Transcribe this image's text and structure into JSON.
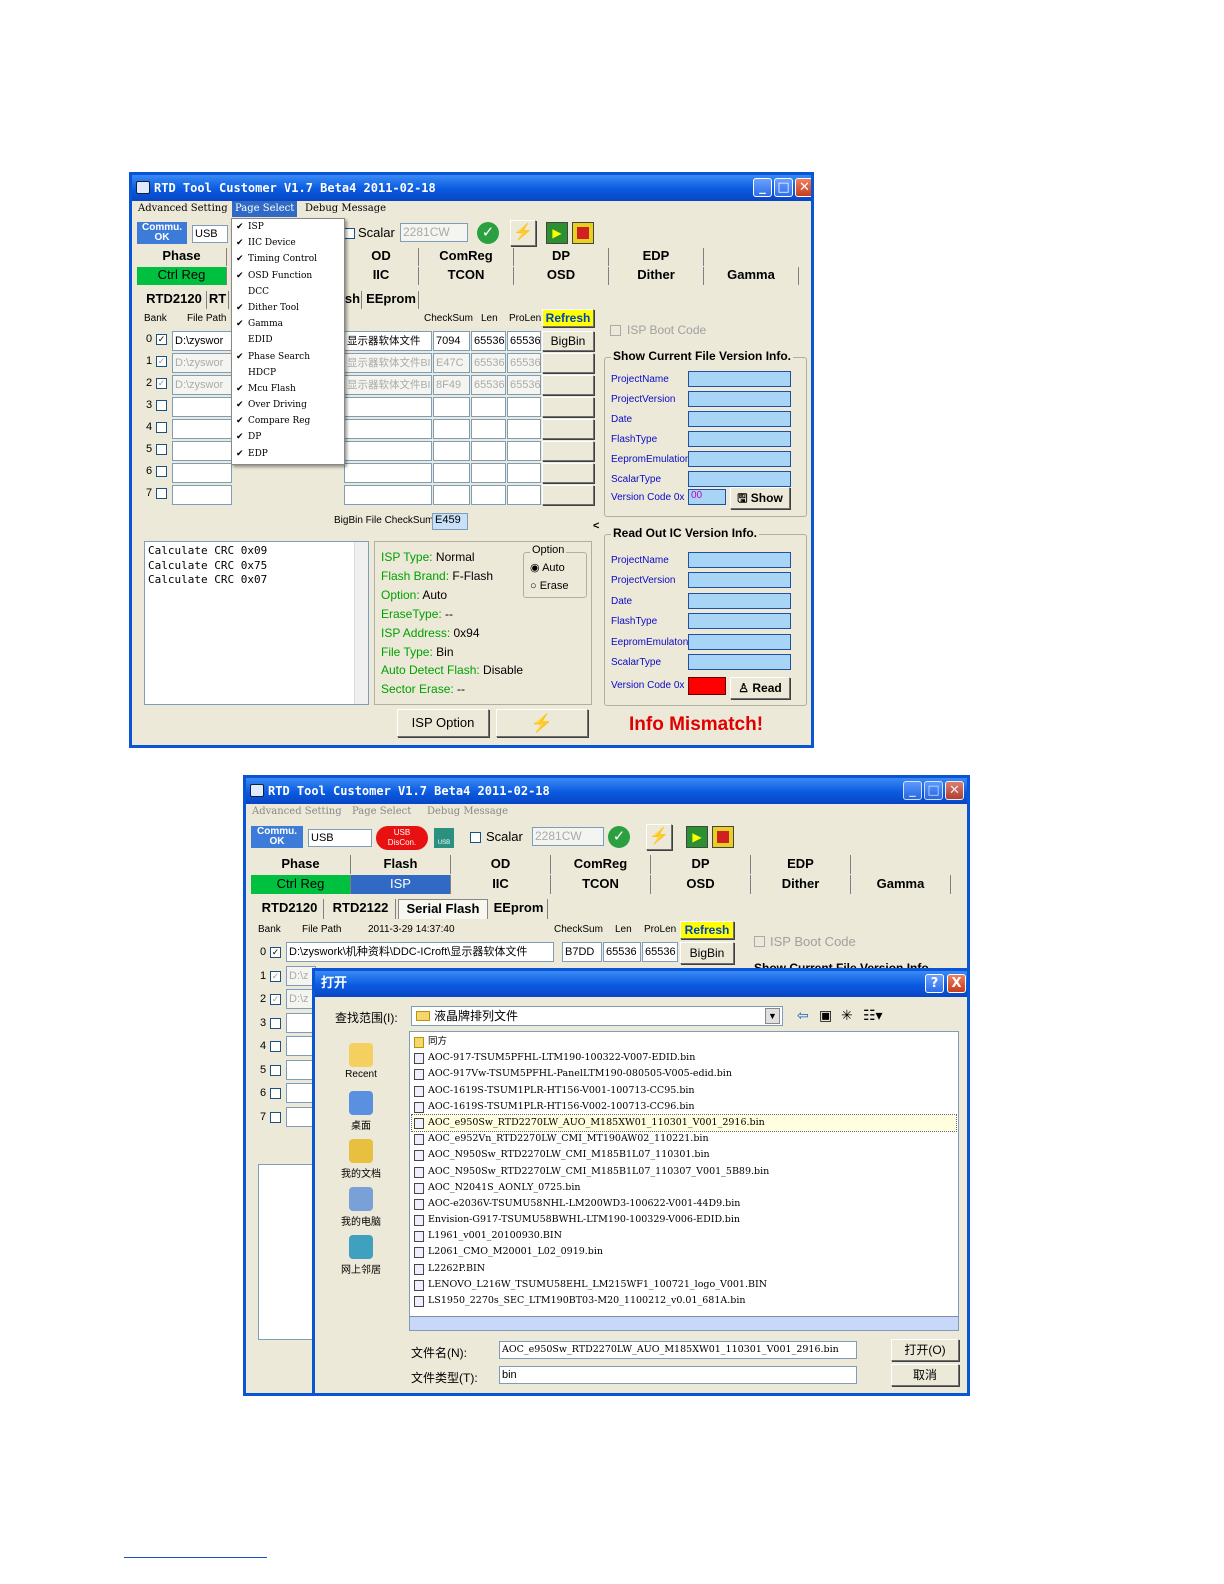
{
  "app_title": "RTD Tool Customer V1.7 Beta4    2011-02-18",
  "app_title2": "RTD Tool Customer V1.7 Beta4    2011-02-18",
  "menu": {
    "advanced": "Advanced Setting",
    "page": "Page Select",
    "debug": "Debug Message"
  },
  "page_menu": [
    {
      "label": "ISP",
      "checked": true
    },
    {
      "label": "IIC Device",
      "checked": true
    },
    {
      "label": "Timing Control",
      "checked": true
    },
    {
      "label": "OSD Function",
      "checked": true
    },
    {
      "label": "DCC",
      "checked": false
    },
    {
      "label": "Dither Tool",
      "checked": true
    },
    {
      "label": "Gamma",
      "checked": true
    },
    {
      "label": "EDID",
      "checked": false
    },
    {
      "label": "Phase Search",
      "checked": true
    },
    {
      "label": "HDCP",
      "checked": false
    },
    {
      "label": "Mcu Flash",
      "checked": true
    },
    {
      "label": "Over Driving",
      "checked": true
    },
    {
      "label": "Compare Reg",
      "checked": true
    },
    {
      "label": "DP",
      "checked": true
    },
    {
      "label": "EDP",
      "checked": true
    }
  ],
  "toolbar": {
    "commu_label": "Commu.",
    "commu_status": "OK",
    "port": "USB",
    "usb_badge1": "USB",
    "usb_badge2": "DisCon.",
    "usb_small": "USB",
    "scalar_label": "Scalar",
    "scalar_value": "2281CW"
  },
  "tabs_row1": [
    "Phase",
    "Flash",
    "OD",
    "ComReg",
    "DP",
    "EDP"
  ],
  "tabs_row2": [
    "Ctrl Reg",
    "ISP",
    "IIC",
    "TCON",
    "OSD",
    "Dither",
    "Gamma"
  ],
  "w1_tabs_partial": {
    "od": "OD",
    "comreg": "ComReg",
    "dp": "DP",
    "edp": "EDP",
    "iic": "IIC",
    "tcon": "TCON",
    "osd": "OSD",
    "dither": "Dither",
    "gamma": "Gamma",
    "phase": "Phase",
    "ctrl": "Ctrl Reg"
  },
  "sub_tabs": [
    "RTD2120",
    "RTD2122",
    "Serial Flash",
    "EEprom"
  ],
  "w1_subtabs": {
    "a": "RTD2120",
    "b": "RT",
    "c": "sh",
    "d": "EEprom"
  },
  "table_headers": {
    "bank": "Bank",
    "file_path": "File Path",
    "checksum": "CheckSum",
    "len": "Len",
    "prolen": "ProLen",
    "refresh": "Refresh",
    "bigbin": "BigBin"
  },
  "rows_w1": [
    {
      "bank": "0",
      "path": "D:\\zyswor",
      "desc": "显示器软体文件",
      "checksum": "7094",
      "len": "65536",
      "prolen": "65536"
    },
    {
      "bank": "1",
      "path": "D:\\zyswor",
      "desc": "显示器软体文件BIN",
      "checksum": "E47C",
      "len": "65536",
      "prolen": "65536"
    },
    {
      "bank": "2",
      "path": "D:\\zyswor",
      "desc": "显示器软体文件BIN",
      "checksum": "8F49",
      "len": "65536",
      "prolen": "65536"
    },
    {
      "bank": "3"
    },
    {
      "bank": "4"
    },
    {
      "bank": "5"
    },
    {
      "bank": "6"
    },
    {
      "bank": "7"
    }
  ],
  "bigbin_checksum_label": "BigBin File CheckSum",
  "bigbin_checksum_value": "E459",
  "crc_log": [
    "Calculate CRC  0x09",
    "Calculate CRC  0x75",
    "Calculate CRC  0x07"
  ],
  "isp_info": [
    {
      "k": "ISP Type:",
      "v": " Normal"
    },
    {
      "k": "Flash Brand:",
      "v": " F-Flash"
    },
    {
      "k": "Option:",
      "v": " Auto"
    },
    {
      "k": "EraseType:",
      "v": " --"
    },
    {
      "k": "ISP Address:",
      "v": " 0x94"
    },
    {
      "k": "File Type:",
      "v": " Bin"
    },
    {
      "k": "Auto Detect Flash:",
      "v": "  Disable"
    },
    {
      "k": "Sector Erase:",
      "v": "  --"
    }
  ],
  "option_group": {
    "title": "Option",
    "auto": "Auto",
    "erase": "Erase"
  },
  "isp_option_btn": "ISP Option",
  "isp_boot_code": "ISP Boot Code",
  "show_version_title": "Show Current File Version Info.",
  "read_version_title": "Read Out IC Version Info.",
  "version_fields": [
    "ProjectName",
    "ProjectVersion",
    "Date",
    "FlashType",
    "EepromEmulation",
    "ScalarType"
  ],
  "version_fields2": [
    "ProjectName",
    "ProjectVersion",
    "Date",
    "FlashType",
    "EepromEmulaton",
    "ScalarType"
  ],
  "version_code_label": "Version Code   0x",
  "version_code_value": "00",
  "show_btn": "Show",
  "read_btn": "Read",
  "info_mismatch": "Info Mismatch!",
  "w2_header_date": "2011-3-29 14:37:40",
  "rows_w2": [
    {
      "bank": "0",
      "path": "D:\\zyswork\\机种资料\\DDC-ICroft\\显示器软体文件",
      "checksum": "B7DD",
      "len": "65536",
      "prolen": "65536"
    },
    {
      "bank": "1",
      "path": "D:\\z"
    },
    {
      "bank": "2",
      "path": "D:\\z"
    },
    {
      "bank": "3"
    },
    {
      "bank": "4"
    },
    {
      "bank": "5"
    },
    {
      "bank": "6"
    },
    {
      "bank": "7"
    }
  ],
  "show_version_title_cut": "Show Current File Version Info.",
  "dialog": {
    "title": "打开",
    "lookin_label": "查找范围(I):",
    "lookin_value": "液晶牌排列文件",
    "places": [
      "Recent",
      "桌面",
      "我的文档",
      "我的电脑",
      "网上邻居"
    ],
    "folder": "同方",
    "files": [
      "AOC-917-TSUM5PFHL-LTM190-100322-V007-EDID.bin",
      "AOC-917Vw-TSUM5PFHL-PanelLTM190-080505-V005-edid.bin",
      "AOC-1619S-TSUM1PLR-HT156-V001-100713-CC95.bin",
      "AOC-1619S-TSUM1PLR-HT156-V002-100713-CC96.bin",
      "AOC_e950Sw_RTD2270LW_AUO_M185XW01_110301_V001_2916.bin",
      "AOC_e952Vn_RTD2270LW_CMI_MT190AW02_110221.bin",
      "AOC_N950Sw_RTD2270LW_CMI_M185B1L07_110301.bin",
      "AOC_N950Sw_RTD2270LW_CMI_M185B1L07_110307_V001_5B89.bin",
      "AOC_N2041S_AONLY_0725.bin",
      "AOC-e2036V-TSUMU58NHL-LM200WD3-100622-V001-44D9.bin",
      "Envision-G917-TSUMU58BWHL-LTM190-100329-V006-EDID.bin",
      "L1961_v001_20100930.BIN",
      "L2061_CMO_M20001_L02_0919.bin",
      "L2262P.BIN",
      "LENOVO_L216W_TSUMU58EHL_LM215WF1_100721_logo_V001.BIN",
      "LS1950_2270s_SEC_LTM190BT03-M20_1100212_v0.01_681A.bin"
    ],
    "selected_index": 4,
    "filename_label": "文件名(N):",
    "filename_value": "AOC_e950Sw_RTD2270LW_AUO_M185XW01_110301_V001_2916.bin",
    "filetype_label": "文件类型(T):",
    "filetype_value": "bin",
    "open_btn": "打开(O)",
    "cancel_btn": "取消",
    "help_btn": "?",
    "close_btn": "X"
  },
  "colors": {
    "title_blue": "#0a54d6",
    "highlight": "#316ac5",
    "green": "#00c040",
    "refresh": "#ffff00",
    "mismatch": "#e00000",
    "usb_red": "#e81010"
  }
}
